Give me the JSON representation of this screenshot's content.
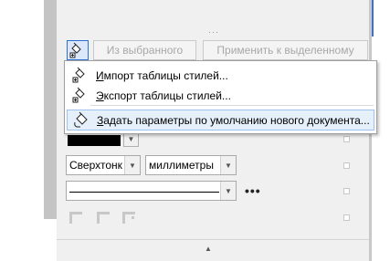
{
  "toolbar": {
    "from_selected_label": "Из выбранного",
    "apply_to_selected_label": "Применить к выделенному"
  },
  "menu": {
    "items": [
      {
        "prefix": "И",
        "label": "мпорт таблицы стилей..."
      },
      {
        "prefix": "Э",
        "label": "кспорт таблицы стилей..."
      },
      {
        "prefix": "З",
        "label": "адать параметры по умолчанию нового документа..."
      }
    ]
  },
  "properties": {
    "line_width_value": "Сверхтонк",
    "units_value": "миллиметры",
    "more_label": "•••",
    "outline_color": "#000000"
  }
}
